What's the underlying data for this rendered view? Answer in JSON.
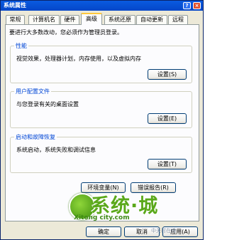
{
  "window": {
    "title": "系统属性",
    "help_glyph": "?",
    "close_glyph": "×"
  },
  "tabs": [
    {
      "label": "常规"
    },
    {
      "label": "计算机名"
    },
    {
      "label": "硬件"
    },
    {
      "label": "高级",
      "active": true
    },
    {
      "label": "系统还原"
    },
    {
      "label": "自动更新"
    },
    {
      "label": "远程"
    }
  ],
  "intro": "要进行大多数改动，您必须作为管理员登录。",
  "groups": {
    "performance": {
      "label": "性能",
      "desc": "视觉效果，处理器计划，内存使用，以及虚拟内存",
      "button": "设置(S)"
    },
    "profiles": {
      "label": "用户配置文件",
      "desc": "与您登录有关的桌面设置",
      "button": "设置(E)"
    },
    "startup": {
      "label": "启动和故障恢复",
      "desc": "系统启动，系统失败和调试信息",
      "button": "设置(T)"
    }
  },
  "env_button": "环境变量(N)",
  "error_button": "错误报告(R)",
  "ok_button": "确定",
  "cancel_button": "取消",
  "apply_button": "应用(A)",
  "watermark": {
    "big": "系统·城",
    "url": "Xitong city.com",
    "corner": "中关村在线"
  }
}
